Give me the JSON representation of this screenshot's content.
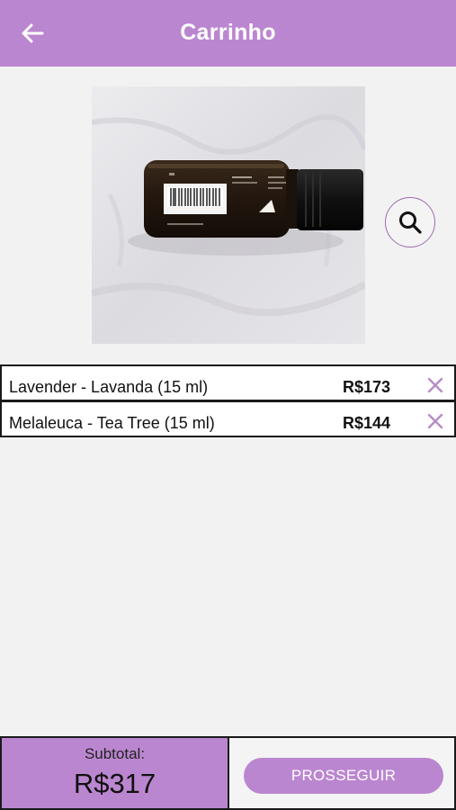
{
  "header": {
    "title": "Carrinho",
    "back_icon": "arrow-left-icon",
    "background": "#bb86d0"
  },
  "product_image": {
    "zoom_icon": "search-icon"
  },
  "cart": {
    "items": [
      {
        "name": "Lavender - Lavanda (15 ml)",
        "price": "R$173",
        "remove_icon": "close-icon"
      },
      {
        "name": "Melaleuca - Tea Tree (15 ml)",
        "price": "R$144",
        "remove_icon": "close-icon"
      }
    ]
  },
  "footer": {
    "subtotal_label": "Subtotal:",
    "subtotal_value": "R$317",
    "proceed_label": "PROSSEGUIR"
  },
  "colors": {
    "accent": "#bb86d0",
    "remove_icon": "#b58cc8"
  }
}
